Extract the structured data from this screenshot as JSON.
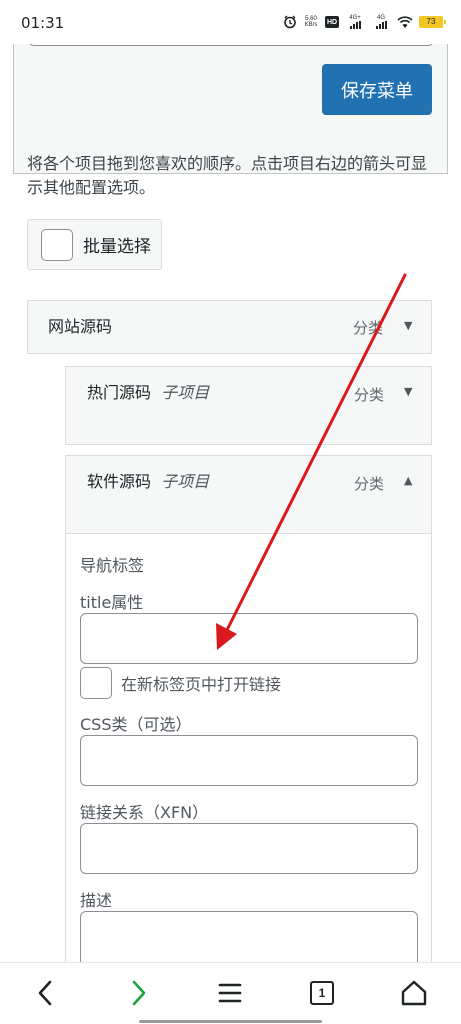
{
  "status_bar": {
    "time": "01:31",
    "net_speed_value": "5.60",
    "net_speed_unit": "KB/s",
    "hd_label": "HD",
    "net_label_1": "4G+",
    "net_label_2": "4G",
    "battery": "73"
  },
  "toolbar": {
    "save_label": "保存菜单"
  },
  "instructions": "将各个项目拖到您喜欢的顺序。点击项目右边的箭头可显示其他配置选项。",
  "bulk_select": {
    "label": "批量选择"
  },
  "menu_items": [
    {
      "title": "网站源码",
      "sub": "",
      "type": "分类",
      "expanded": false
    },
    {
      "title": "热门源码",
      "sub": "子项目",
      "type": "分类",
      "expanded": false
    },
    {
      "title": "软件源码",
      "sub": "子项目",
      "type": "分类",
      "expanded": true
    }
  ],
  "settings": {
    "nav_label": "导航标签",
    "title_attr_label": "title属性",
    "new_tab_label": "在新标签页中打开链接",
    "css_label": "CSS类（可选）",
    "xfn_label": "链接关系（XFN）",
    "desc_label": "描述"
  },
  "bottom_nav": {
    "tab_count": "1"
  },
  "colors": {
    "accent": "#2271b1",
    "annotation_arrow": "#d9191c",
    "forward_arrow": "#1aa33b"
  }
}
